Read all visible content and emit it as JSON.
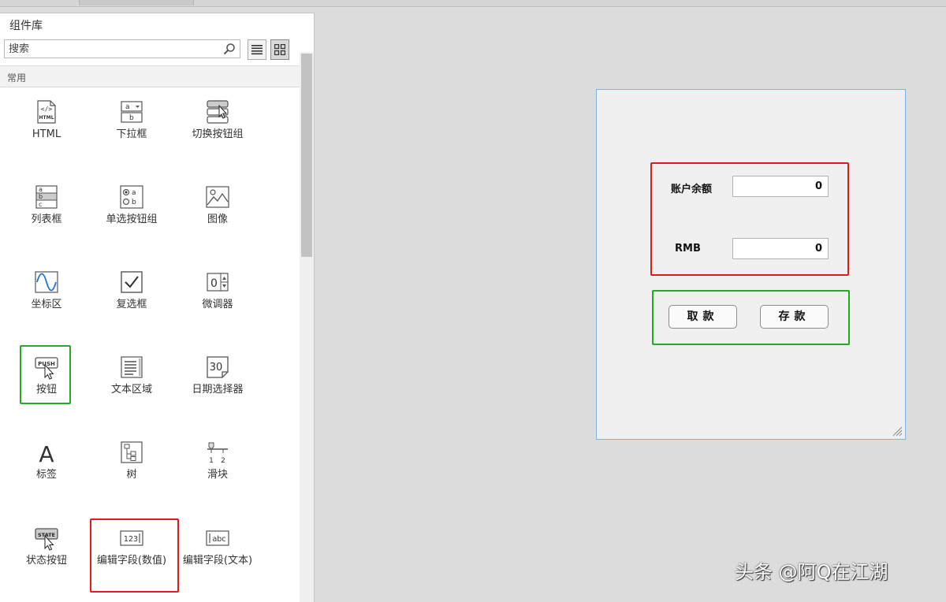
{
  "library": {
    "title": "组件库",
    "search_placeholder": "搜索",
    "section": "常用",
    "components": [
      {
        "label": "HTML"
      },
      {
        "label": "下拉框"
      },
      {
        "label": "切换按钮组"
      },
      {
        "label": "列表框"
      },
      {
        "label": "单选按钮组"
      },
      {
        "label": "图像"
      },
      {
        "label": "坐标区"
      },
      {
        "label": "复选框"
      },
      {
        "label": "微调器"
      },
      {
        "label": "按钮",
        "push_text": "PUSH"
      },
      {
        "label": "文本区域"
      },
      {
        "label": "日期选择器",
        "date_text": "30"
      },
      {
        "label": "标签",
        "glyph": "A"
      },
      {
        "label": "树"
      },
      {
        "label": "滑块"
      },
      {
        "label": "状态按钮",
        "state_text": "STATE"
      },
      {
        "label": "编辑字段(数值)",
        "icon_text": "123"
      },
      {
        "label": "编辑字段(文本)",
        "icon_text": "abc"
      }
    ]
  },
  "figure": {
    "balance_label": "账户余额",
    "balance_value": "0",
    "rmb_label": "RMB",
    "rmb_value": "0",
    "withdraw_label": "取款",
    "deposit_label": "存款"
  },
  "highlight_colors": {
    "green": "#22aa22",
    "red": "#e11a1a"
  },
  "watermark": "头条 @阿Q在江湖"
}
